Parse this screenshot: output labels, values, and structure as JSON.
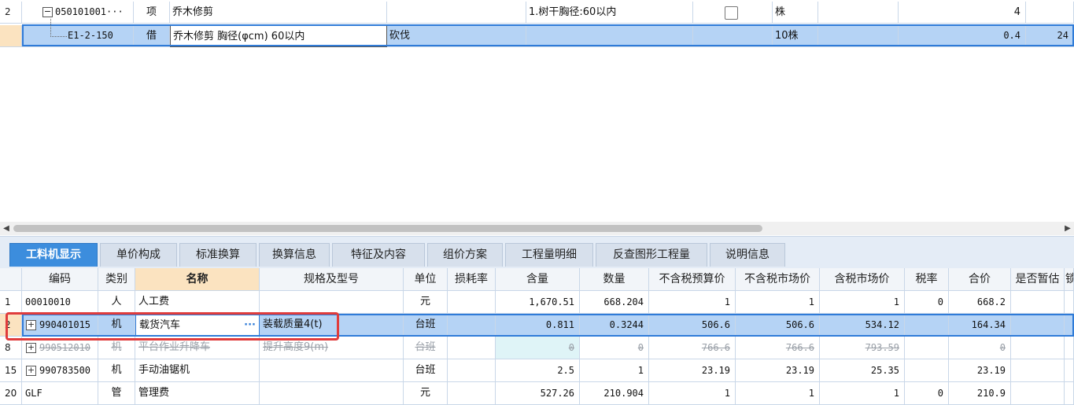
{
  "upper_grid": {
    "rows": [
      {
        "num": "2",
        "code": "050101001···",
        "type": "项",
        "name": "乔木修剪",
        "feature": "1.树干胸径:60以内",
        "unit": "株",
        "qty": "4"
      },
      {
        "num": "",
        "code": "E1-2-150",
        "type": "借",
        "name": "乔木修剪 胸径(φcm) 60以内",
        "spec": "砍伐",
        "unit": "10株",
        "qty": "0.4",
        "price": "24"
      }
    ]
  },
  "tabs": [
    "工料机显示",
    "单价构成",
    "标准换算",
    "换算信息",
    "特征及内容",
    "组价方案",
    "工程量明细",
    "反查图形工程量",
    "说明信息"
  ],
  "lower_grid": {
    "headers": {
      "code": "编码",
      "type": "类别",
      "name": "名称",
      "spec": "规格及型号",
      "unit": "单位",
      "loss": "损耗率",
      "content": "含量",
      "qty": "数量",
      "pretax_budget": "不含税预算价",
      "pretax_market": "不含税市场价",
      "tax_market": "含税市场价",
      "tax_rate": "税率",
      "total": "合价",
      "is_estimate": "是否暂估",
      "extra": "锁"
    },
    "rows": [
      {
        "num": "1",
        "code": "00010010",
        "type": "人",
        "name": "人工费",
        "spec": "",
        "unit": "元",
        "content": "1,670.51",
        "qty": "668.204",
        "pretax_budget": "1",
        "pretax_market": "1",
        "tax_market": "1",
        "tax_rate": "0",
        "total": "668.2"
      },
      {
        "num": "2",
        "code": "990401015",
        "type": "机",
        "name": "载货汽车",
        "spec": "装载质量4(t)",
        "unit": "台班",
        "content": "0.811",
        "qty": "0.3244",
        "pretax_budget": "506.6",
        "pretax_market": "506.6",
        "tax_market": "534.12",
        "tax_rate": "",
        "total": "164.34"
      },
      {
        "num": "8",
        "code": "990512010",
        "type": "机",
        "name": "平台作业升降车",
        "spec": "提升高度9(m)",
        "unit": "台班",
        "content": "0",
        "qty": "0",
        "pretax_budget": "766.6",
        "pretax_market": "766.6",
        "tax_market": "793.59",
        "tax_rate": "",
        "total": "0"
      },
      {
        "num": "15",
        "code": "990783500",
        "type": "机",
        "name": "手动油锯机",
        "spec": "",
        "unit": "台班",
        "content": "2.5",
        "qty": "1",
        "pretax_budget": "23.19",
        "pretax_market": "23.19",
        "tax_market": "25.35",
        "tax_rate": "",
        "total": "23.19"
      },
      {
        "num": "20",
        "code": "GLF",
        "type": "管",
        "name": "管理费",
        "spec": "",
        "unit": "元",
        "content": "527.26",
        "qty": "210.904",
        "pretax_budget": "1",
        "pretax_market": "1",
        "tax_market": "1",
        "tax_rate": "0",
        "total": "210.9"
      }
    ]
  },
  "colors": {
    "accent": "#3c8ddd",
    "selection": "#b5d3f5",
    "highlight_box": "#e03c3c",
    "header_highlight": "#fbe3c0"
  }
}
